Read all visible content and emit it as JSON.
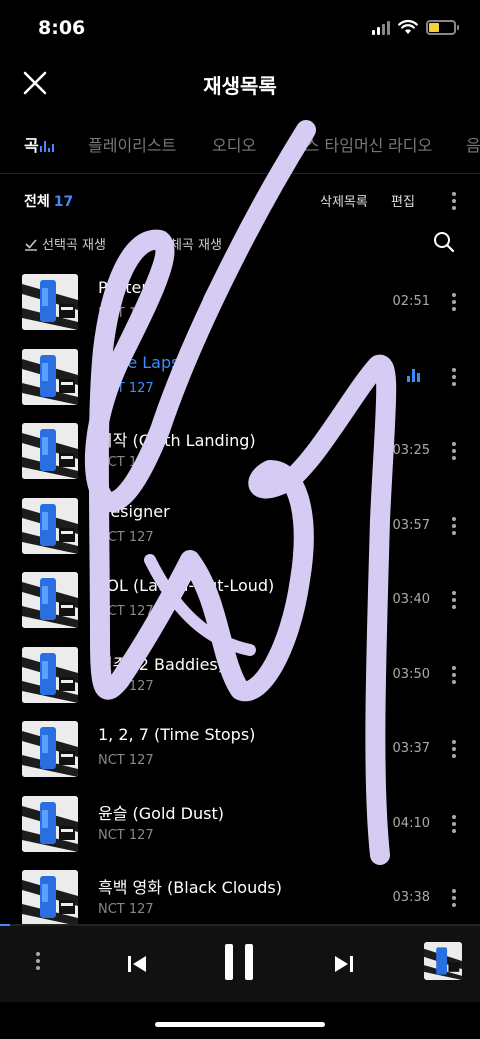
{
  "status": {
    "time": "8:06"
  },
  "header": {
    "title": "재생목록"
  },
  "tabs": [
    {
      "label": "곡",
      "active": true
    },
    {
      "label": "플레이리스트"
    },
    {
      "label": "오디오"
    },
    {
      "label": "믹스 타임머신"
    },
    {
      "label": "라디오"
    },
    {
      "label": "음"
    }
  ],
  "toolbar": {
    "total_label": "전체",
    "total_count": "17",
    "deleted_label": "삭제목록",
    "edit_label": "편집"
  },
  "actions": {
    "play_selected": "선택곡 재생",
    "play_all": "전체곡 재생"
  },
  "songs": [
    {
      "title": "Poster",
      "artist": "NCT 127",
      "duration": "02:51"
    },
    {
      "title": "Time Lapse",
      "artist": "NCT 127",
      "duration": "",
      "playing": true
    },
    {
      "title": "시작 (Cloth Landing)",
      "artist": "NCT 127",
      "duration": "03:25"
    },
    {
      "title": "Designer",
      "artist": "NCT 127",
      "duration": "03:57"
    },
    {
      "title": "LOL (Laugh-Out-Loud)",
      "artist": "NCT 127",
      "duration": "03:40"
    },
    {
      "title": "질주 (2 Baddies)",
      "artist": "NCT 127",
      "duration": "03:50"
    },
    {
      "title": "1, 2, 7 (Time Stops)",
      "artist": "NCT 127",
      "duration": "03:37"
    },
    {
      "title": "윤슬 (Gold Dust)",
      "artist": "NCT 127",
      "duration": "04:10"
    },
    {
      "title": "흑백 영화 (Black Clouds)",
      "artist": "NCT 127",
      "duration": "03:38"
    }
  ],
  "player": {
    "progress": 0.02
  },
  "colors": {
    "accent": "#3d8bff",
    "scribble": "#d6ccf3"
  },
  "icons": [
    "close-icon",
    "search-icon",
    "more-vert-icon",
    "previous-icon",
    "pause-icon",
    "next-icon"
  ]
}
